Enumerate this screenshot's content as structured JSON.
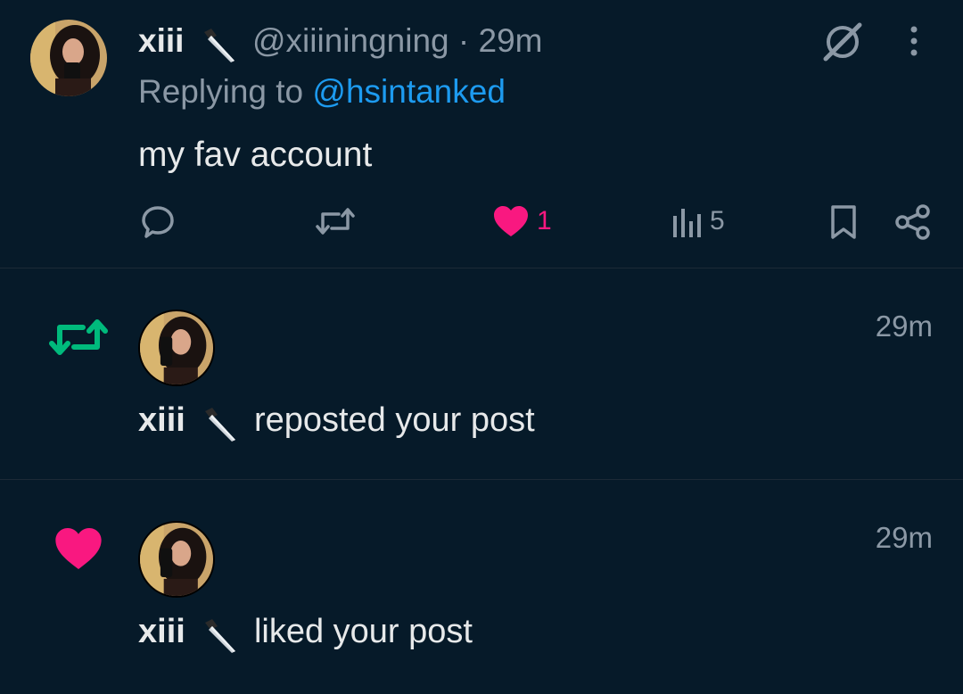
{
  "tweet": {
    "display_name": "xiii",
    "handle": "@xiiiningning",
    "separator": "·",
    "time": "29m",
    "replying_prefix": "Replying to",
    "replying_handle": "@hsintanked",
    "text": "my fav account",
    "actions": {
      "reply_icon": "reply-icon",
      "repost_icon": "repost-icon",
      "like_count": "1",
      "views_count": "5",
      "bookmark_icon": "bookmark-icon",
      "share_icon": "share-icon"
    },
    "grok_icon": "grok-icon",
    "more_icon": "more-icon"
  },
  "notifications": [
    {
      "type": "repost",
      "icon": "repost-icon",
      "name": "xiii",
      "text": "reposted your post",
      "time": "29m"
    },
    {
      "type": "like",
      "icon": "heart-icon",
      "name": "xiii",
      "text": "liked your post",
      "time": "29m"
    }
  ],
  "colors": {
    "background": "#061a29",
    "link": "#1d9bf0",
    "like": "#f91880",
    "repost": "#00ba7c",
    "muted": "#8b98a5"
  }
}
